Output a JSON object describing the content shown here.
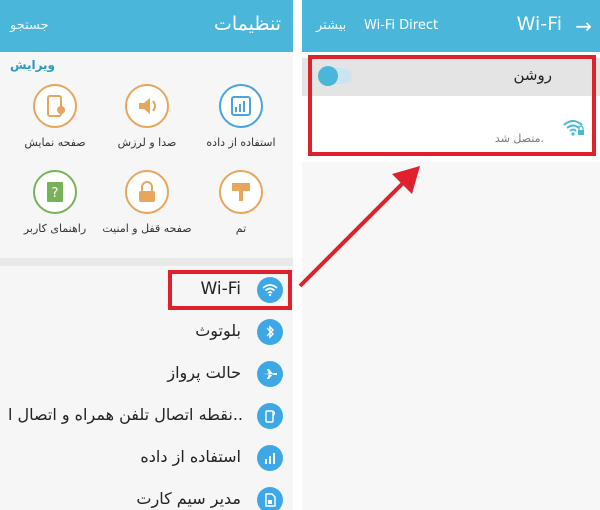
{
  "left_panel": {
    "title": "تنظیمات",
    "search": "جستجو",
    "edit": "ویرایش",
    "grid": [
      {
        "label": "استفاده از داده",
        "icon": "data-usage-icon"
      },
      {
        "label": "صدا و لرزش",
        "icon": "sound-icon"
      },
      {
        "label": "صفحه نمایش",
        "icon": "display-icon"
      },
      {
        "label": "تم",
        "icon": "theme-icon"
      },
      {
        "label": "صفحه قفل و امنیت",
        "icon": "lock-icon"
      },
      {
        "label": "راهنمای کاربر",
        "icon": "help-icon"
      }
    ],
    "list": [
      {
        "label": "Wi-Fi",
        "icon": "wifi-icon"
      },
      {
        "label": "بلوتوث",
        "icon": "bluetooth-icon"
      },
      {
        "label": "حالت پرواز",
        "icon": "airplane-icon"
      },
      {
        "label": "نقطه اتصال تلفن همراه و اتصال ا..",
        "icon": "hotspot-icon"
      },
      {
        "label": "استفاده از داده",
        "icon": "data-usage-icon"
      },
      {
        "label": "مدیر سیم کارت",
        "icon": "sim-icon"
      }
    ]
  },
  "right_panel": {
    "title": "Wi-Fi",
    "wifi_direct": "Wi-Fi Direct",
    "more": "بیشتر",
    "toggle_label": "روشن",
    "toggle_on": true,
    "network_status": "متصل شد."
  },
  "colors": {
    "accent": "#4ab6d9",
    "highlight": "#e0202a"
  }
}
